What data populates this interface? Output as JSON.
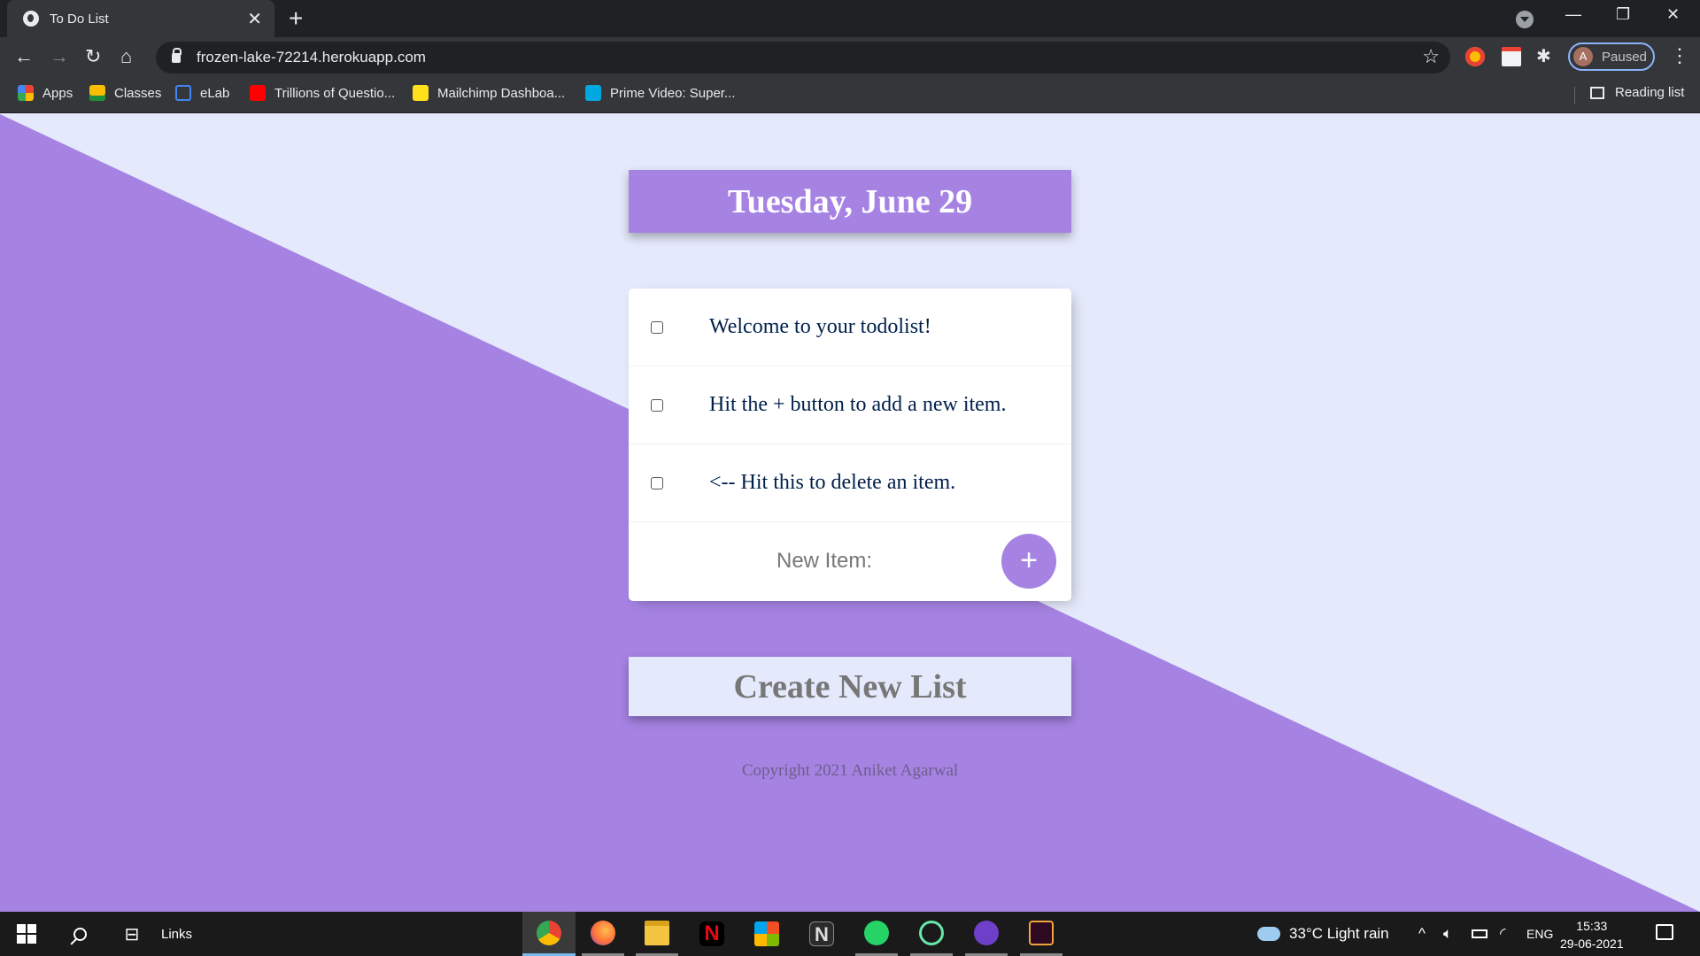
{
  "browser": {
    "tab_title": "To Do List",
    "tab_close": "✕",
    "new_tab": "+",
    "url": "frozen-lake-72214.herokuapp.com",
    "profile_initial": "A",
    "profile_status": "Paused",
    "window_minimize": "—",
    "window_restore": "❐",
    "window_close": "✕"
  },
  "bookmarks": {
    "items": [
      {
        "label": "Apps",
        "icon": "apps-grid-icon"
      },
      {
        "label": "Classes",
        "icon": "google-classroom-icon"
      },
      {
        "label": "eLab",
        "icon": "elab-icon"
      },
      {
        "label": "Trillions of Questio...",
        "icon": "youtube-icon"
      },
      {
        "label": "Mailchimp Dashboa...",
        "icon": "mailchimp-icon"
      },
      {
        "label": "Prime Video: Super...",
        "icon": "prime-video-icon"
      }
    ],
    "reading_list": "Reading list"
  },
  "page": {
    "heading": "Tuesday, June 29",
    "items": [
      {
        "text": "Welcome to your todolist!"
      },
      {
        "text": "Hit the + button to add a new item."
      },
      {
        "text": "<-- Hit this to delete an item."
      }
    ],
    "new_item_placeholder": "New Item:",
    "add_button": "+",
    "create_button": "Create New List",
    "footer": "Copyright 2021 Aniket Agarwal"
  },
  "colors": {
    "accent": "#a683e3",
    "background": "#e4e9fb"
  },
  "taskbar": {
    "links_label": "Links",
    "apps": [
      "chrome-icon",
      "firefox-icon",
      "file-explorer-icon",
      "netflix-icon",
      "microsoft-store-icon",
      "notion-icon",
      "whatsapp-icon",
      "atom-icon",
      "github-desktop-icon",
      "terminal-icon"
    ],
    "weather": "33°C  Light rain",
    "language": "ENG",
    "time": "15:33",
    "date": "29-06-2021"
  }
}
